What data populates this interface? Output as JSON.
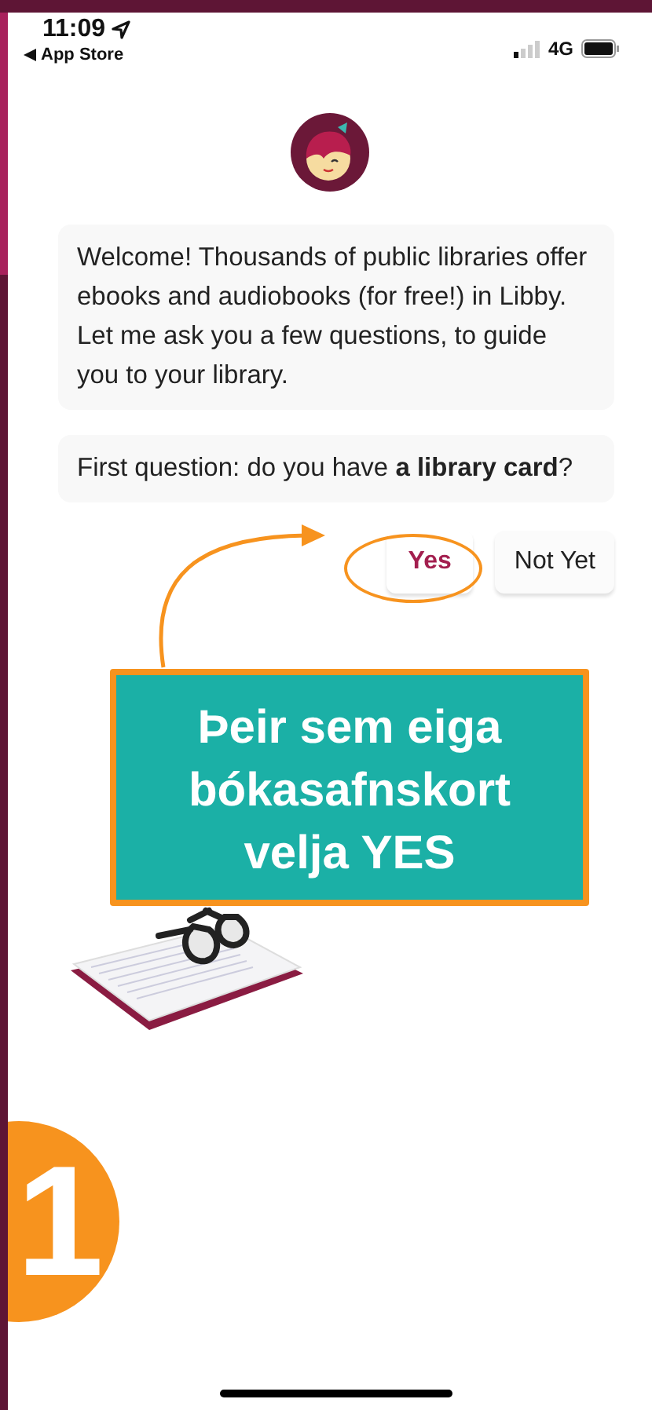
{
  "status_bar": {
    "time": "11:09",
    "back_label": "App Store",
    "network": "4G"
  },
  "messages": [
    {
      "text": "Welcome! Thousands of public libraries offer ebooks and audiobooks (for free!) in Libby. Let me ask you a few questions, to guide you to your library."
    },
    {
      "text": "First question: do you have **a library card**?"
    }
  ],
  "answers": [
    {
      "label": "Yes",
      "primary": true
    },
    {
      "label": "Not Yet",
      "primary": false
    }
  ],
  "annotation": {
    "text": "Þeir sem eiga bókasafnskort velja YES",
    "step": "1"
  }
}
